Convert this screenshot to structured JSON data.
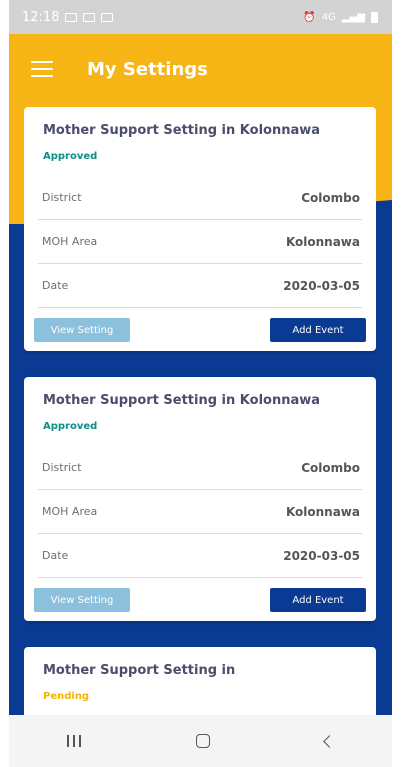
{
  "status_bar": {
    "time": "12:18",
    "signal_text": "4G"
  },
  "app_bar": {
    "title": "My Settings"
  },
  "cards": [
    {
      "title": "Mother Support Setting in Kolonnawa",
      "status": "Approved",
      "rows": [
        {
          "label": "District",
          "value": "Colombo"
        },
        {
          "label": "MOH Area",
          "value": "Kolonnawa"
        },
        {
          "label": "Date",
          "value": "2020-03-05"
        }
      ],
      "view_label": "View Setting",
      "add_label": "Add Event"
    },
    {
      "title": "Mother Support Setting in Kolonnawa",
      "status": "Approved",
      "rows": [
        {
          "label": "District",
          "value": "Colombo"
        },
        {
          "label": "MOH Area",
          "value": "Kolonnawa"
        },
        {
          "label": "Date",
          "value": "2020-03-05"
        }
      ],
      "view_label": "View Setting",
      "add_label": "Add Event"
    },
    {
      "title": "Mother Support Setting in",
      "status": "Pending"
    }
  ],
  "colors": {
    "primary": "#0a3a93",
    "accent": "#f7b515",
    "approved": "#0a8f86",
    "pending": "#f4b400",
    "view_button": "#8cc1de"
  },
  "icons": [
    "mail-icon",
    "image-icon",
    "check-icon",
    "alarm-icon",
    "signal-icon",
    "battery-icon",
    "menu-icon",
    "recents-icon",
    "home-icon",
    "back-icon"
  ]
}
